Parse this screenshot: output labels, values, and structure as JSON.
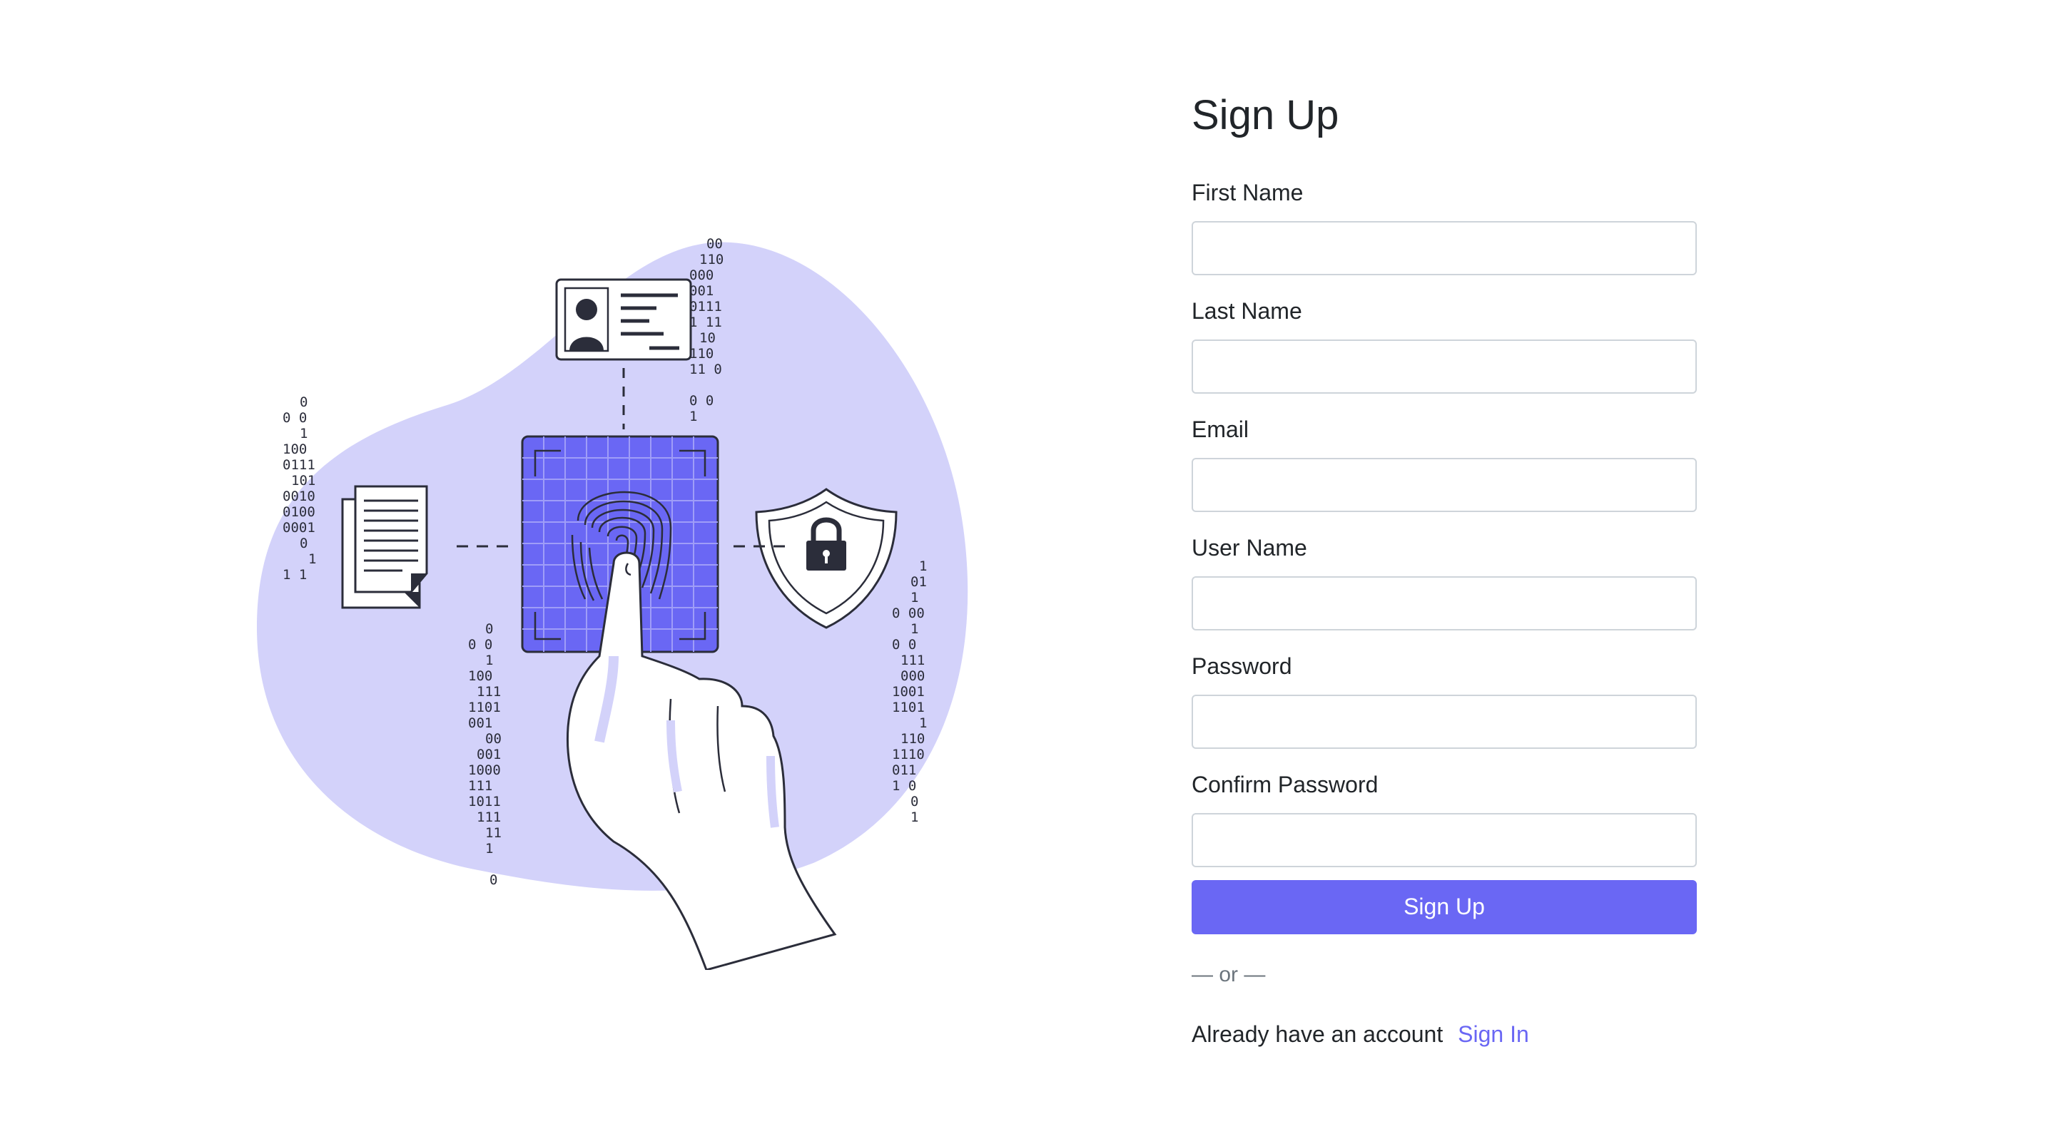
{
  "form": {
    "title": "Sign Up",
    "fields": [
      {
        "label": "First Name",
        "value": "",
        "placeholder": ""
      },
      {
        "label": "Last Name",
        "value": "",
        "placeholder": ""
      },
      {
        "label": "Email",
        "value": "",
        "placeholder": ""
      },
      {
        "label": "User Name",
        "value": "",
        "placeholder": ""
      },
      {
        "label": "Password",
        "value": "",
        "placeholder": ""
      },
      {
        "label": "Confirm Password",
        "value": "",
        "placeholder": ""
      }
    ],
    "submit_label": "Sign Up",
    "divider": "— or —",
    "signin_prompt": "Already have an account",
    "signin_link": "Sign In"
  },
  "illustration": {
    "icons": [
      "fingerprint-icon",
      "id-card-icon",
      "document-icon",
      "shield-lock-icon",
      "hand-icon"
    ]
  },
  "colors": {
    "accent": "#6a67f4",
    "blob": "#d3d2fa",
    "scanner": "#6a67f4",
    "ink": "#2b2d3a"
  }
}
